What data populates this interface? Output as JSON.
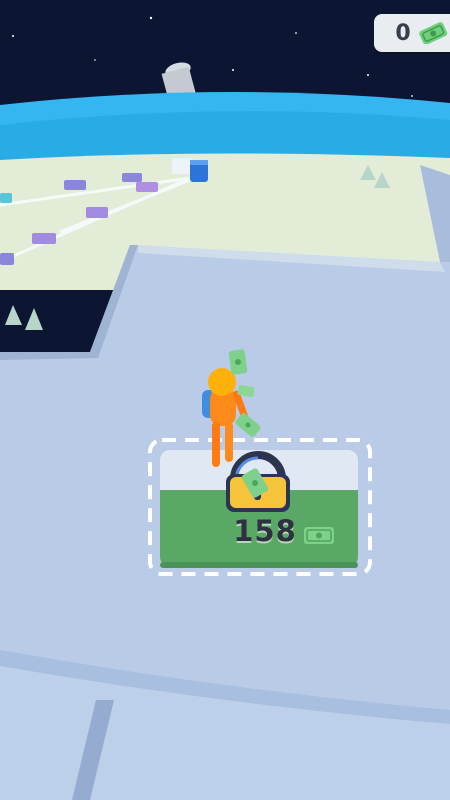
{
  "hud": {
    "money_count": "0",
    "money_icon": "cash-icon"
  },
  "unlock_zone": {
    "price": "158",
    "lock_icon": "padlock-icon",
    "currency_icon": "cash-icon"
  },
  "colors": {
    "space": "#0c1633",
    "ocean": "#35b6f0",
    "land": "#e2ecd6",
    "platform": "#b9cbe6",
    "zone_green": "#5aa866",
    "lock_yellow": "#f5c43a",
    "cash_green": "#7fd08a",
    "character_orange": "#ff8a1c",
    "character_backpack": "#3f8ee0"
  }
}
